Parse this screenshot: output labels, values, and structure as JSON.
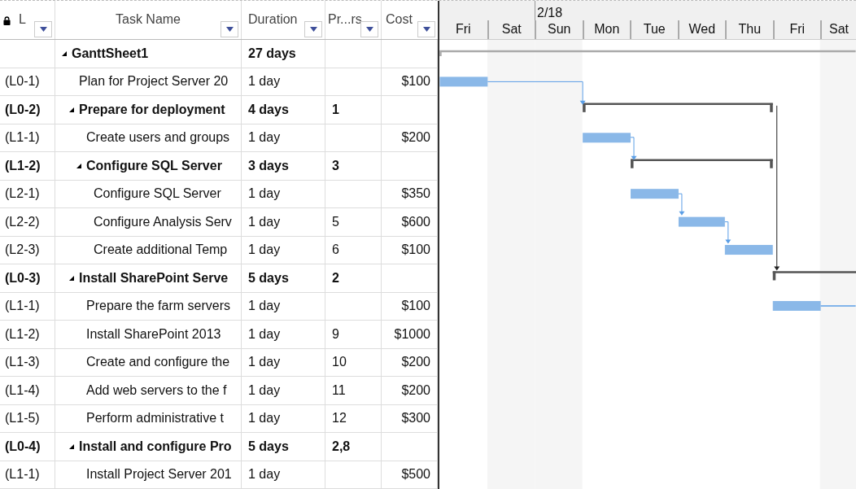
{
  "grid": {
    "columns": [
      {
        "kind": "level",
        "label": "L"
      },
      {
        "kind": "name",
        "label": "Task Name"
      },
      {
        "kind": "duration",
        "label": "Duration"
      },
      {
        "kind": "predecessors",
        "label": "Pr...rs"
      },
      {
        "kind": "cost",
        "label": "Cost"
      }
    ],
    "rows": [
      {
        "kind": "summary",
        "expanded": true,
        "name": "GanttSheet1",
        "duration": "27 days",
        "children": [
          {
            "kind": "task",
            "id": "(L0-1)",
            "name": "Plan for Project Server 20",
            "duration": "1 day",
            "cost": "$100"
          },
          {
            "kind": "summary",
            "expanded": true,
            "id": "(L0-2)",
            "name": "Prepare for deployment",
            "duration": "4 days",
            "predecessors": "1",
            "children": [
              {
                "kind": "task",
                "id": "(L1-1)",
                "name": "Create users and groups",
                "duration": "1 day",
                "cost": "$200"
              },
              {
                "kind": "summary",
                "expanded": true,
                "id": "(L1-2)",
                "name": "Configure SQL Server",
                "duration": "3 days",
                "predecessors": "3",
                "children": [
                  {
                    "kind": "task",
                    "id": "(L2-1)",
                    "name": "Configure SQL Server",
                    "duration": "1 day",
                    "cost": "$350"
                  },
                  {
                    "kind": "task",
                    "id": "(L2-2)",
                    "name": "Configure Analysis Serv",
                    "duration": "1 day",
                    "predecessors": "5",
                    "cost": "$600"
                  },
                  {
                    "kind": "task",
                    "id": "(L2-3)",
                    "name": "Create additional Temp",
                    "duration": "1 day",
                    "predecessors": "6",
                    "cost": "$100"
                  }
                ]
              }
            ]
          },
          {
            "kind": "summary",
            "expanded": true,
            "id": "(L0-3)",
            "name": "Install SharePoint Serve",
            "duration": "5 days",
            "predecessors": "2",
            "children": [
              {
                "kind": "task",
                "id": "(L1-1)",
                "name": "Prepare the farm servers",
                "duration": "1 day",
                "cost": "$100"
              },
              {
                "kind": "task",
                "id": "(L1-2)",
                "name": "Install SharePoint 2013",
                "duration": "1 day",
                "predecessors": "9",
                "cost": "$1000"
              },
              {
                "kind": "task",
                "id": "(L1-3)",
                "name": "Create and configure the",
                "duration": "1 day",
                "predecessors": "10",
                "cost": "$200"
              },
              {
                "kind": "task",
                "id": "(L1-4)",
                "name": "Add web servers to the f",
                "duration": "1 day",
                "predecessors": "11",
                "cost": "$200"
              },
              {
                "kind": "task",
                "id": "(L1-5)",
                "name": "Perform administrative t",
                "duration": "1 day",
                "predecessors": "12",
                "cost": "$300"
              }
            ]
          },
          {
            "kind": "summary",
            "expanded": true,
            "id": "(L0-4)",
            "name": "Install and configure Pro",
            "duration": "5 days",
            "predecessors": "2,8",
            "children": [
              {
                "kind": "task",
                "id": "(L1-1)",
                "name": "Install Project Server 201",
                "duration": "1 day",
                "cost": "$500"
              }
            ]
          }
        ]
      }
    ]
  },
  "timeline": {
    "days": [
      {
        "label": "Fri",
        "weekend": false
      },
      {
        "label": "Sat",
        "weekend": true
      },
      {
        "label": "Sun",
        "weekend": true,
        "week_label": "2/18"
      },
      {
        "label": "Mon",
        "weekend": false
      },
      {
        "label": "Tue",
        "weekend": false
      },
      {
        "label": "Wed",
        "weekend": false
      },
      {
        "label": "Thu",
        "weekend": false
      },
      {
        "label": "Fri",
        "weekend": false
      },
      {
        "label": "Sat",
        "weekend": true
      }
    ]
  }
}
